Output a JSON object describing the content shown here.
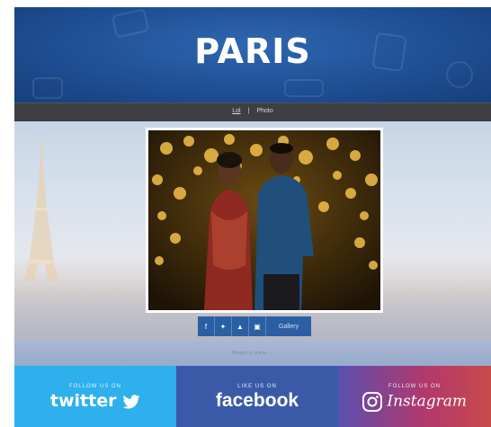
{
  "header": {
    "logo_text": "PARIS"
  },
  "nav": {
    "items": [
      "Lol",
      "Photo"
    ],
    "separator": "|"
  },
  "share": {
    "buttons": [
      {
        "icon": "facebook-icon",
        "glyph": "f"
      },
      {
        "icon": "twitter-icon",
        "glyph": "✦"
      },
      {
        "icon": "upload-icon",
        "glyph": "▲"
      },
      {
        "icon": "save-icon",
        "glyph": "▣"
      }
    ],
    "gallery_label": "Gallery"
  },
  "footer_note": "Brought to you by ....",
  "social": {
    "twitter": {
      "follow": "FOLLOW US ON",
      "brand": "twitter",
      "color": "#2eb0ec"
    },
    "facebook": {
      "follow": "LIKE US ON",
      "brand": "facebook",
      "color": "#3a5aa8"
    },
    "instagram": {
      "follow": "FOLLOW US ON",
      "brand": "Instagram"
    }
  },
  "colors": {
    "header": "#1f4f95",
    "nav": "#3d3f44",
    "share_button": "#2a5fa3"
  }
}
